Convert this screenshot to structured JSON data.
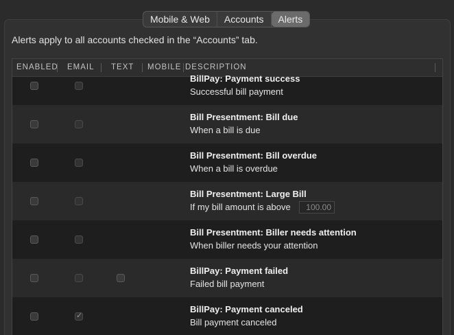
{
  "tabs": [
    {
      "label": "Mobile & Web",
      "active": false
    },
    {
      "label": "Accounts",
      "active": false
    },
    {
      "label": "Alerts",
      "active": true
    }
  ],
  "intro_text": "Alerts apply to all accounts checked in the “Accounts” tab.",
  "columns": [
    "ENABLED",
    "EMAIL",
    "TEXT",
    "MOBILE",
    "DESCRIPTION"
  ],
  "alerts": [
    {
      "title": "BillPay: Payment success",
      "subtitle": "Successful bill payment",
      "enabled": false,
      "email": false,
      "email_checked": false,
      "text_checkbox": false
    },
    {
      "title": "Bill Presentment: Bill due",
      "subtitle": "When a bill is due",
      "enabled": false,
      "email": false,
      "email_checked": false,
      "text_checkbox": false
    },
    {
      "title": "Bill Presentment: Bill overdue",
      "subtitle": "When a bill is overdue",
      "enabled": false,
      "email": false,
      "email_checked": false,
      "text_checkbox": false
    },
    {
      "title": "Bill Presentment: Large Bill",
      "subtitle": "If my bill amount is above",
      "amount": "100.00",
      "enabled": false,
      "email": false,
      "email_checked": false,
      "text_checkbox": false
    },
    {
      "title": "Bill Presentment: Biller needs attention",
      "subtitle": "When biller needs your attention",
      "enabled": false,
      "email": false,
      "email_checked": false,
      "text_checkbox": false
    },
    {
      "title": "BillPay: Payment failed",
      "subtitle": "Failed bill payment",
      "enabled": false,
      "email": false,
      "email_checked": false,
      "text_checkbox": true
    },
    {
      "title": "BillPay: Payment canceled",
      "subtitle": "Bill payment canceled",
      "enabled": false,
      "email": true,
      "email_checked": true,
      "text_checkbox": false
    }
  ]
}
